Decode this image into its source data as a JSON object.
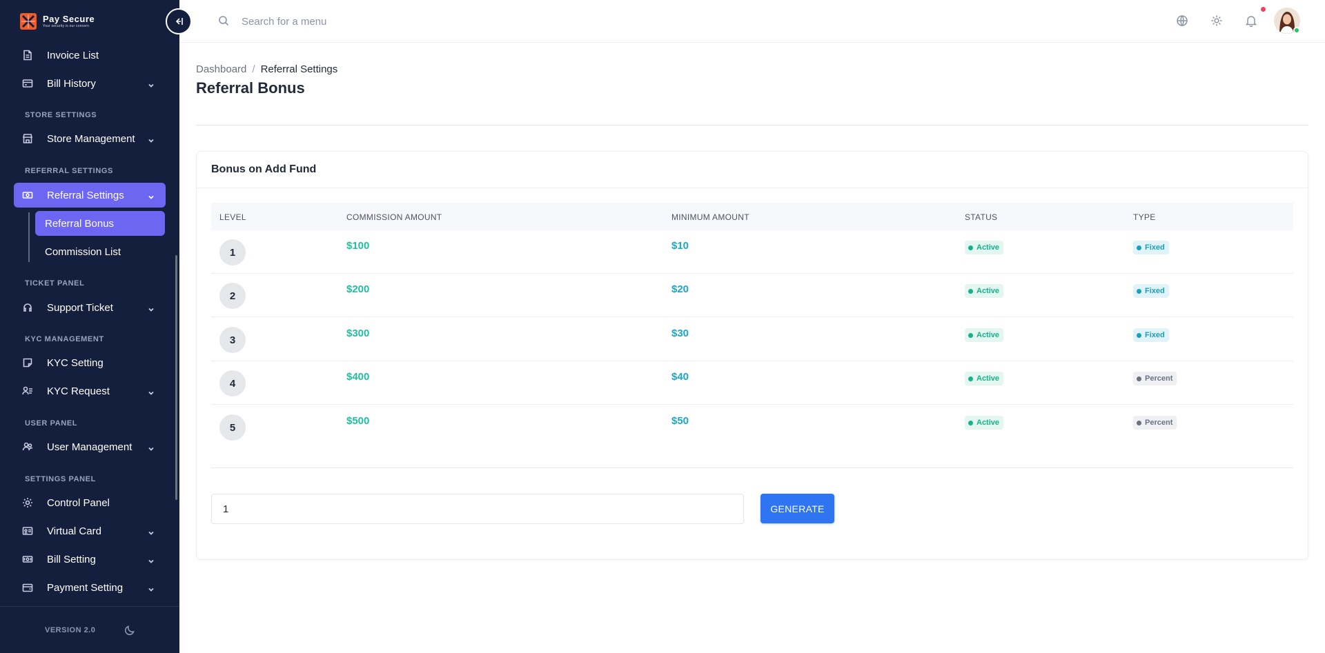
{
  "brand": {
    "name": "Pay Secure",
    "tagline": "Your security is our concern",
    "accent": "#6d66f2"
  },
  "sidebar": {
    "items": [
      {
        "key": "invoice_list",
        "label": "Invoice List",
        "icon": "document-icon",
        "has_chevron": false
      },
      {
        "key": "bill_history",
        "label": "Bill History",
        "icon": "receipt-icon",
        "has_chevron": true
      },
      {
        "key": "store_management",
        "label": "Store Management",
        "icon": "store-icon",
        "has_chevron": true
      },
      {
        "key": "referral_settings",
        "label": "Referral Settings",
        "icon": "money-icon",
        "has_chevron": true,
        "active": true
      },
      {
        "key": "support_ticket",
        "label": "Support Ticket",
        "icon": "headset-icon",
        "has_chevron": true
      },
      {
        "key": "kyc_setting",
        "label": "KYC Setting",
        "icon": "sticky-note-icon",
        "has_chevron": false
      },
      {
        "key": "kyc_request",
        "label": "KYC Request",
        "icon": "user-list-icon",
        "has_chevron": true
      },
      {
        "key": "user_management",
        "label": "User Management",
        "icon": "users-icon",
        "has_chevron": true
      },
      {
        "key": "control_panel",
        "label": "Control Panel",
        "icon": "gear-icon",
        "has_chevron": false
      },
      {
        "key": "virtual_card",
        "label": "Virtual Card",
        "icon": "id-card-icon",
        "has_chevron": true
      },
      {
        "key": "bill_setting",
        "label": "Bill Setting",
        "icon": "banknote-icon",
        "has_chevron": true
      },
      {
        "key": "payment_setting",
        "label": "Payment Setting",
        "icon": "wallet-icon",
        "has_chevron": true
      }
    ],
    "sections": {
      "store": "STORE SETTINGS",
      "referral": "REFERRAL SETTINGS",
      "ticket": "TICKET PANEL",
      "kyc": "KYC MANAGEMENT",
      "user": "USER PANEL",
      "settings": "SETTINGS PANEL"
    },
    "sub_items": [
      {
        "label": "Referral Bonus",
        "active": true
      },
      {
        "label": "Commission List",
        "active": false
      }
    ],
    "version": "VERSION 2.0"
  },
  "header": {
    "search_placeholder": "Search for a menu",
    "icons": [
      "globe-icon",
      "settings-icon",
      "bell-icon",
      "avatar"
    ]
  },
  "breadcrumb": {
    "parent": "Dashboard",
    "separator": "/",
    "current": "Referral Settings"
  },
  "page_title": "Referral Bonus",
  "card": {
    "title": "Bonus on Add Fund",
    "columns": [
      "LEVEL",
      "COMMISSION AMOUNT",
      "MINIMUM AMOUNT",
      "STATUS",
      "TYPE"
    ],
    "rows": [
      {
        "level": "1",
        "commission": "$100",
        "minimum": "$10",
        "status": "Active",
        "type": "Fixed"
      },
      {
        "level": "2",
        "commission": "$200",
        "minimum": "$20",
        "status": "Active",
        "type": "Fixed"
      },
      {
        "level": "3",
        "commission": "$300",
        "minimum": "$30",
        "status": "Active",
        "type": "Fixed"
      },
      {
        "level": "4",
        "commission": "$400",
        "minimum": "$40",
        "status": "Active",
        "type": "Percent"
      },
      {
        "level": "5",
        "commission": "$500",
        "minimum": "$50",
        "status": "Active",
        "type": "Percent"
      }
    ],
    "level_input_value": "1",
    "generate_label": "GENERATE"
  },
  "colors": {
    "sidebar_bg": "#141f3d",
    "commission_text": "#1fc0a0",
    "minimum_text": "#1aa8c2",
    "primary_button": "#2f74f0",
    "notification_dot": "#f43f5e"
  }
}
